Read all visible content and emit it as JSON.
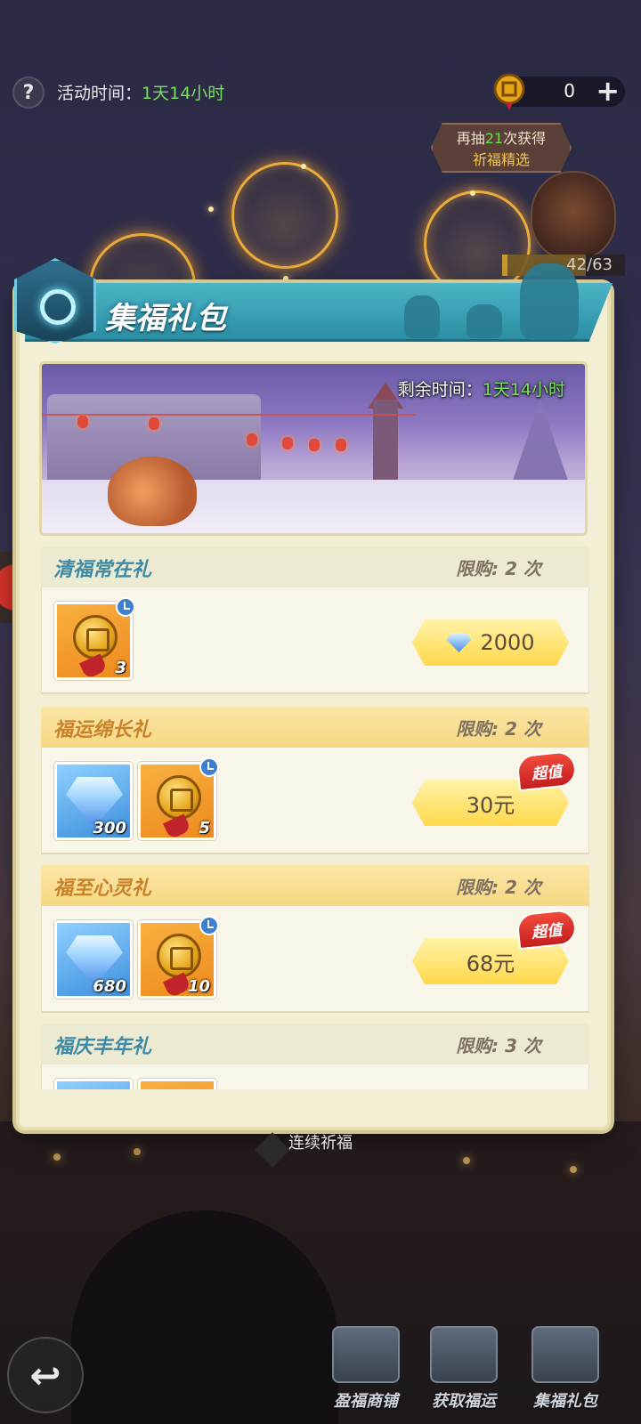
{
  "top": {
    "event_time_label": "活动时间：",
    "event_time_value": "1天14小时",
    "currency_amount": "0",
    "currency_plus": "+"
  },
  "draw_tip": {
    "prefix": "再抽",
    "count": "21",
    "suffix": "次获得",
    "reward": "祈福精选"
  },
  "progress": {
    "text": "42/63",
    "current": 42,
    "total": 63
  },
  "panel": {
    "title": "集福礼包",
    "remaining_label": "剩余时间：",
    "remaining_value": "1天14小时"
  },
  "offers": [
    {
      "name": "清福常在礼",
      "limit": "限购: 2 次",
      "items": [
        {
          "icon": "lucky-coin-icon",
          "qty": "3"
        }
      ],
      "price": "2000",
      "price_icon": "diamond-icon"
    },
    {
      "name": "福运绵长礼",
      "limit": "限购: 2 次",
      "items": [
        {
          "icon": "diamond-icon",
          "qty": "300"
        },
        {
          "icon": "lucky-coin-icon",
          "qty": "5"
        }
      ],
      "price": "30元",
      "badge": "超值"
    },
    {
      "name": "福至心灵礼",
      "limit": "限购: 2 次",
      "items": [
        {
          "icon": "diamond-icon",
          "qty": "680"
        },
        {
          "icon": "lucky-coin-icon",
          "qty": "10"
        }
      ],
      "price": "68元",
      "badge": "超值"
    },
    {
      "name": "福庆丰年礼",
      "limit": "限购: 3 次"
    }
  ],
  "footer": {
    "label": "连续祈福"
  },
  "nav": [
    {
      "label": "盈福商铺"
    },
    {
      "label": "获取福运"
    },
    {
      "label": "集福礼包"
    }
  ],
  "colors": {
    "panel_bg": "#f3efd5",
    "header_teal": "#2c8ea4",
    "green_text": "#78e05a",
    "price_yellow": "#ffd84a",
    "hot_red": "#d82a28"
  }
}
